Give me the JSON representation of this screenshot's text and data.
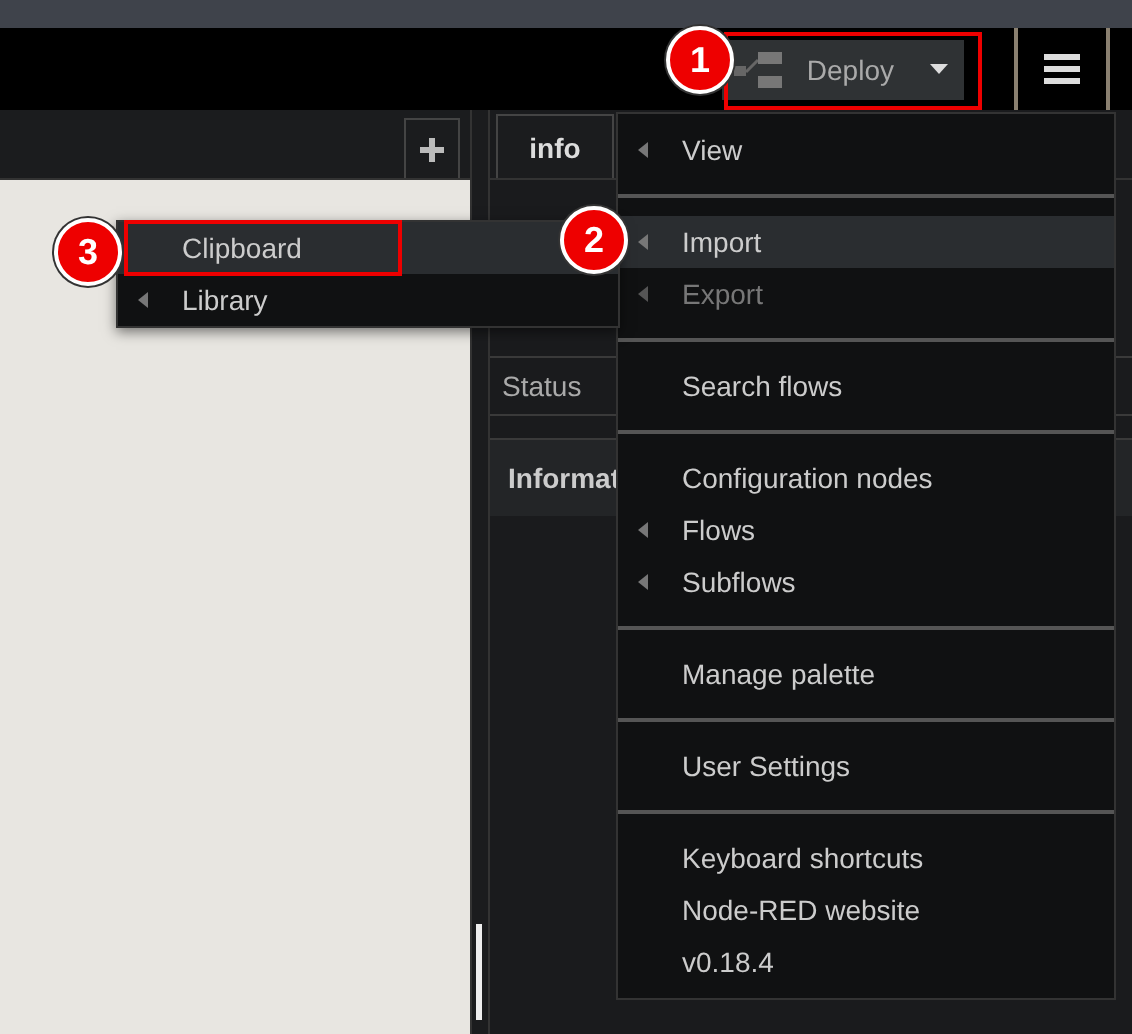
{
  "header": {
    "deploy_button": {
      "label": "Deploy"
    }
  },
  "sidebar": {
    "tabs": [
      {
        "label": "info",
        "selected": true
      }
    ],
    "info_rows": [
      "Status"
    ],
    "section_title": "Informat"
  },
  "main_menu": {
    "groups": [
      [
        {
          "label": "View",
          "kind": "submenu",
          "selected": false,
          "disabled": false
        }
      ],
      [
        {
          "label": "Import",
          "kind": "submenu",
          "selected": true,
          "disabled": false
        },
        {
          "label": "Export",
          "kind": "submenu",
          "selected": false,
          "disabled": true
        }
      ],
      [
        {
          "label": "Search flows",
          "kind": "action",
          "selected": false,
          "disabled": false
        }
      ],
      [
        {
          "label": "Configuration nodes",
          "kind": "action",
          "selected": false,
          "disabled": false
        },
        {
          "label": "Flows",
          "kind": "submenu",
          "selected": false,
          "disabled": false
        },
        {
          "label": "Subflows",
          "kind": "submenu",
          "selected": false,
          "disabled": false
        }
      ],
      [
        {
          "label": "Manage palette",
          "kind": "action",
          "selected": false,
          "disabled": false
        }
      ],
      [
        {
          "label": "User Settings",
          "kind": "action",
          "selected": false,
          "disabled": false
        }
      ],
      [
        {
          "label": "Keyboard shortcuts",
          "kind": "action",
          "selected": false,
          "disabled": false
        },
        {
          "label": "Node-RED website",
          "kind": "action",
          "selected": false,
          "disabled": false
        },
        {
          "label": "v0.18.4",
          "kind": "action",
          "selected": false,
          "disabled": false
        }
      ]
    ]
  },
  "import_submenu": {
    "items": [
      {
        "label": "Clipboard",
        "kind": "action",
        "selected": true,
        "disabled": false
      },
      {
        "label": "Library",
        "kind": "submenu",
        "selected": false,
        "disabled": false
      }
    ]
  },
  "callouts": [
    {
      "number": "1"
    },
    {
      "number": "2"
    },
    {
      "number": "3"
    }
  ]
}
